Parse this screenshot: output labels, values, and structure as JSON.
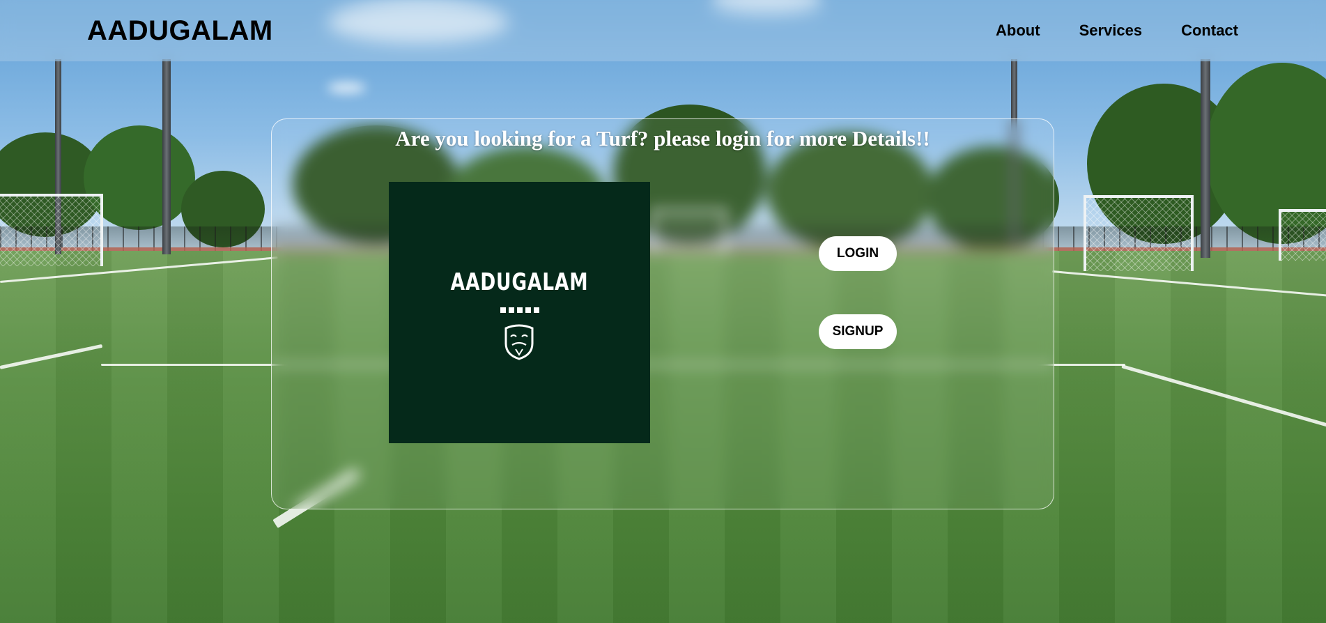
{
  "header": {
    "brand": "AADUGALAM",
    "nav": [
      {
        "label": "About"
      },
      {
        "label": "Services"
      },
      {
        "label": "Contact"
      }
    ]
  },
  "card": {
    "title": "Are you looking for a Turf? please login for more Details!!",
    "logo": {
      "wordmark": "AADUGALAM",
      "icon": "mask-shield-icon",
      "background": "#05291a"
    },
    "login_label": "LOGIN",
    "signup_label": "SIGNUP"
  },
  "background": {
    "scene": "football-turf-photo"
  }
}
